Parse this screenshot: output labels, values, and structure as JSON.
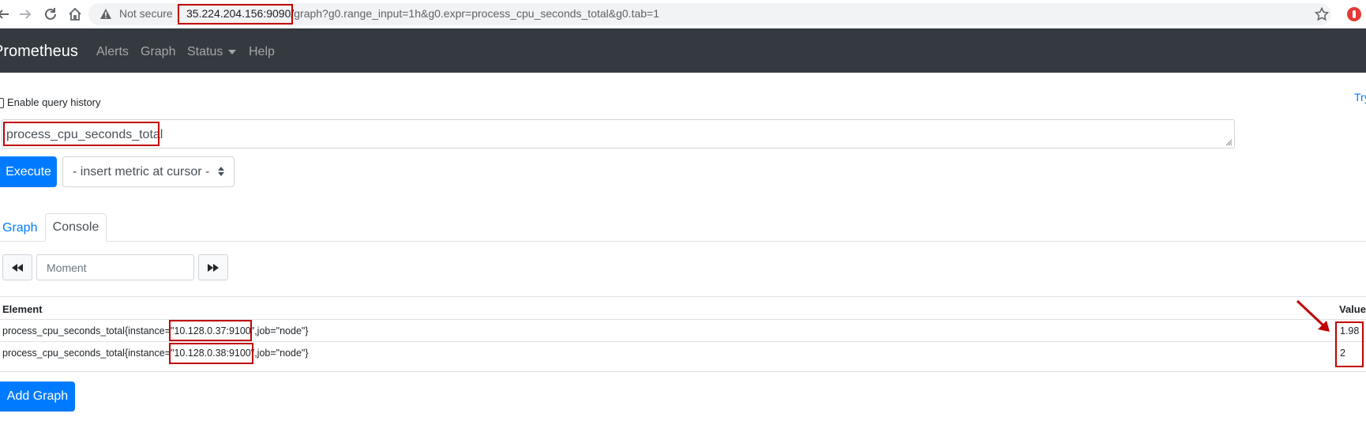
{
  "browser": {
    "security_label": "Not secure",
    "url_host": "35.224.204.156:9090/",
    "url_rest": "graph?g0.range_input=1h&g0.expr=process_cpu_seconds_total&g0.tab=1"
  },
  "navbar": {
    "brand": "Prometheus",
    "links": [
      "Alerts",
      "Graph",
      "Status",
      "Help"
    ]
  },
  "query": {
    "history_label": "Enable query history",
    "try_link": "Try",
    "expression": "process_cpu_seconds_total",
    "execute_label": "Execute",
    "metric_select_label": "- insert metric at cursor -"
  },
  "tabs": {
    "graph": "Graph",
    "console": "Console"
  },
  "moment": {
    "placeholder": "Moment"
  },
  "table": {
    "headers": {
      "element": "Element",
      "value": "Value"
    },
    "rows": [
      {
        "prefix": "process_cpu_seconds_total{instance=\"",
        "instance": "10.128.0.37:9100\"",
        "suffix": ",job=\"node\"}",
        "value": "1.98"
      },
      {
        "prefix": "process_cpu_seconds_total{instance=\"",
        "instance": "10.128.0.38:9100\"",
        "suffix": ",job=\"node\"}",
        "value": "2"
      }
    ]
  },
  "add_graph_label": "Add Graph",
  "colors": {
    "navbar": "#343a40",
    "primary": "#007bff",
    "annotation": "#c00000"
  },
  "icons": [
    "back-arrow-icon",
    "forward-arrow-icon",
    "reload-icon",
    "home-icon",
    "warning-icon",
    "star-icon",
    "extension-icon",
    "rewind-icon",
    "fast-forward-icon",
    "caret-down-icon",
    "select-arrows-icon"
  ]
}
